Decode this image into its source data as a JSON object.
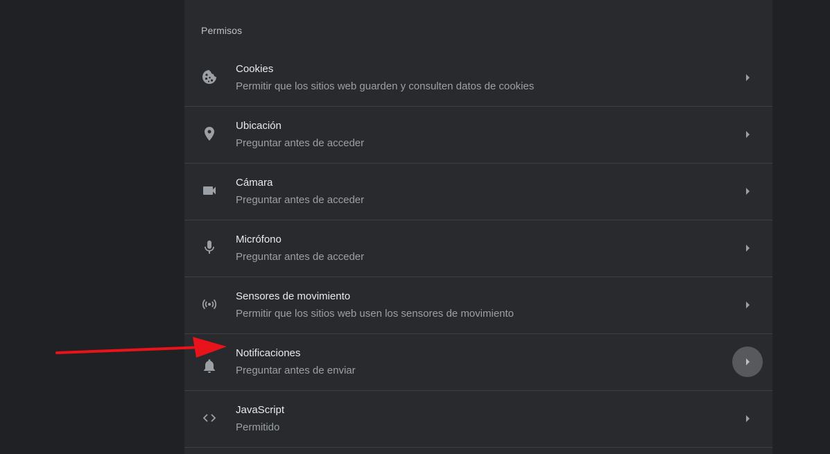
{
  "section": {
    "title": "Permisos"
  },
  "rows": [
    {
      "label": "Cookies",
      "sub": "Permitir que los sitios web guarden y consulten datos de cookies"
    },
    {
      "label": "Ubicación",
      "sub": "Preguntar antes de acceder"
    },
    {
      "label": "Cámara",
      "sub": "Preguntar antes de acceder"
    },
    {
      "label": "Micrófono",
      "sub": "Preguntar antes de acceder"
    },
    {
      "label": "Sensores de movimiento",
      "sub": "Permitir que los sitios web usen los sensores de movimiento"
    },
    {
      "label": "Notificaciones",
      "sub": "Preguntar antes de enviar"
    },
    {
      "label": "JavaScript",
      "sub": "Permitido"
    }
  ],
  "colors": {
    "background": "#202124",
    "panel": "#292a2d",
    "text_primary": "#e8eaed",
    "text_secondary": "#9aa0a6",
    "icon": "#9aa0a6",
    "annotation_arrow": "#e8131b"
  },
  "icons": [
    "cookie-icon",
    "location-pin-icon",
    "camera-icon",
    "microphone-icon",
    "motion-sensor-icon",
    "bell-icon",
    "code-icon",
    "chevron-right-icon"
  ]
}
